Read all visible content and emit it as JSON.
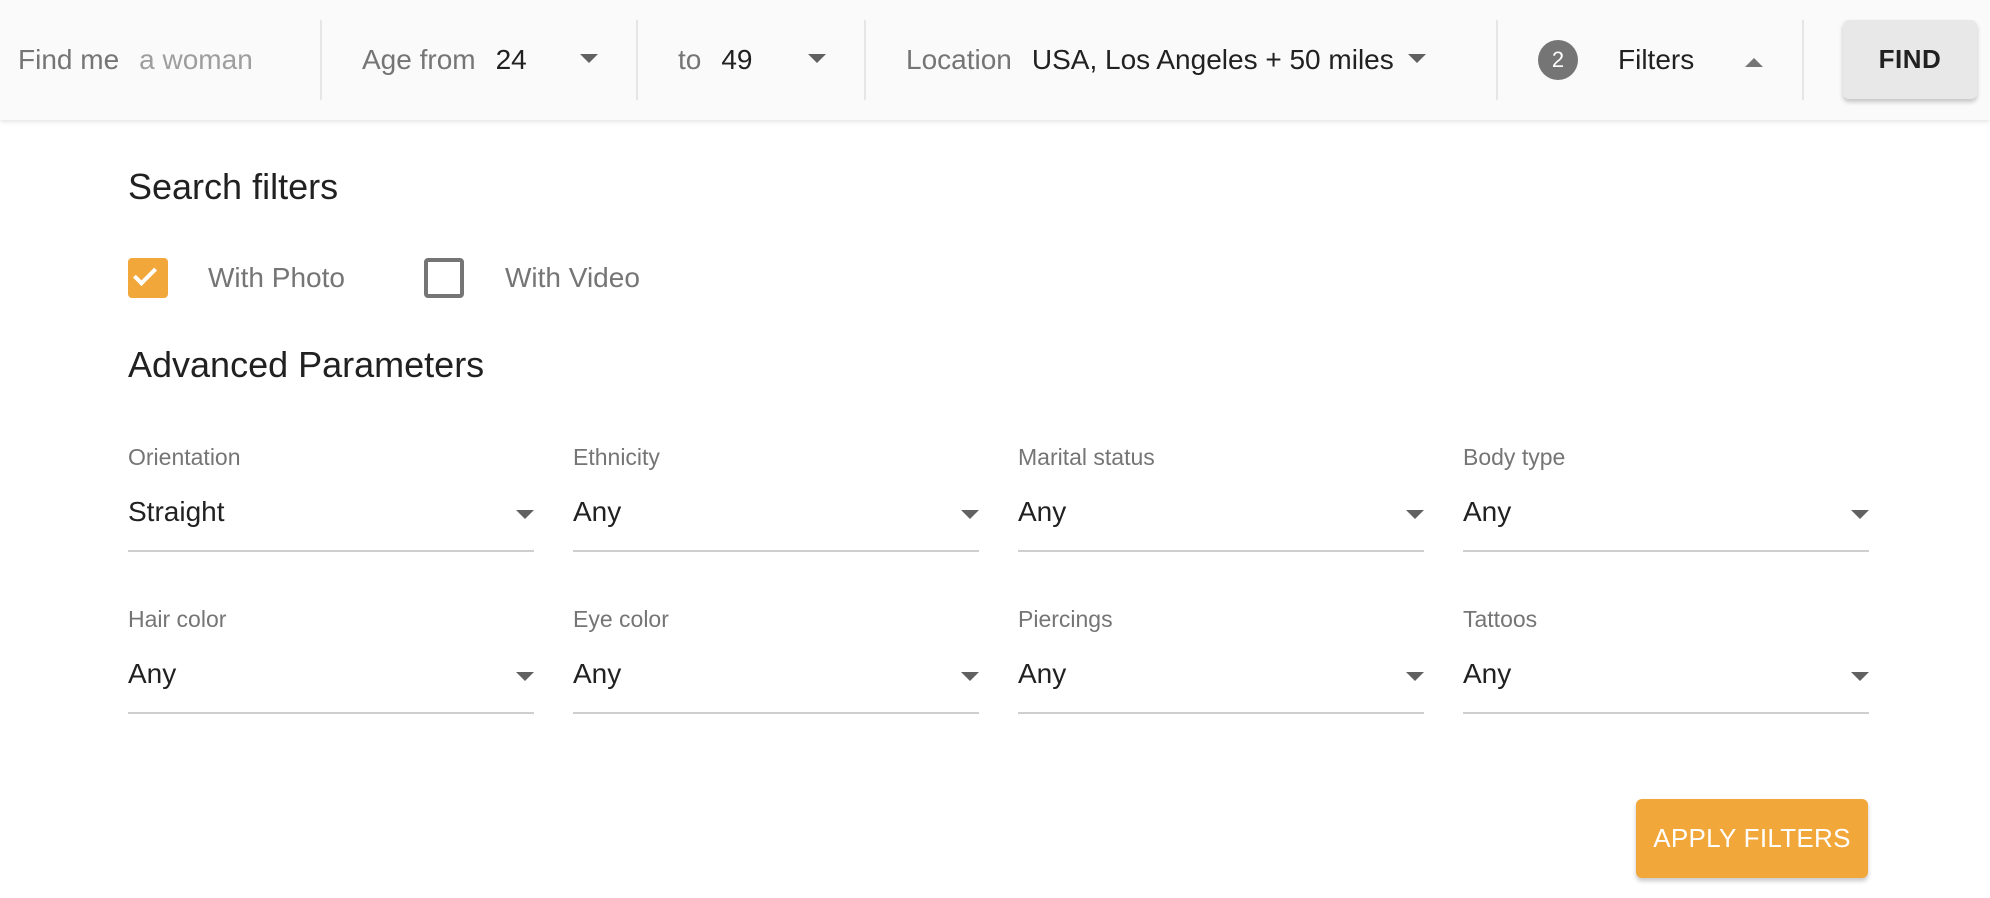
{
  "search": {
    "find_label": "Find me",
    "find_value": "a woman",
    "age_from_label": "Age from",
    "age_from_value": "24",
    "age_to_label": "to",
    "age_to_value": "49",
    "location_label": "Location",
    "location_value": "USA, Los Angeles + 50 miles",
    "filters_count": "2",
    "filters_label": "Filters",
    "find_button": "FIND"
  },
  "panel": {
    "title": "Search filters",
    "with_photo": {
      "label": "With Photo",
      "checked": true
    },
    "with_video": {
      "label": "With Video",
      "checked": false
    },
    "advanced_title": "Advanced Parameters",
    "fields": [
      {
        "label": "Orientation",
        "value": "Straight"
      },
      {
        "label": "Ethnicity",
        "value": "Any"
      },
      {
        "label": "Marital status",
        "value": "Any"
      },
      {
        "label": "Body type",
        "value": "Any"
      },
      {
        "label": "Hair color",
        "value": "Any"
      },
      {
        "label": "Eye color",
        "value": "Any"
      },
      {
        "label": "Piercings",
        "value": "Any"
      },
      {
        "label": "Tattoos",
        "value": "Any"
      }
    ],
    "apply_button": "APPLY FILTERS"
  },
  "colors": {
    "accent": "#f2a73b",
    "badge": "#757575",
    "bar_background": "#fafafa"
  }
}
